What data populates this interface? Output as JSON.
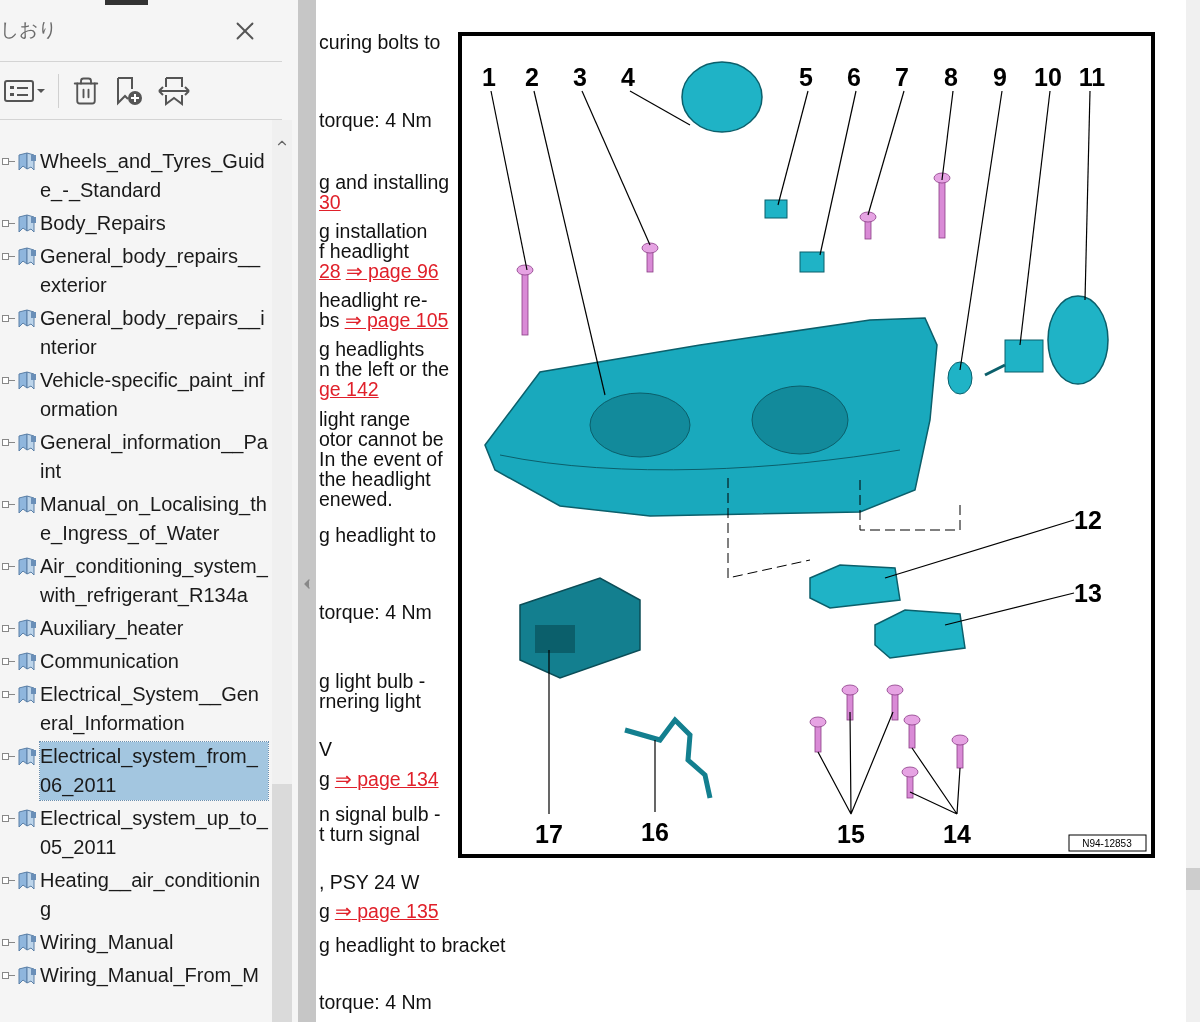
{
  "sidebar": {
    "title": "しおり",
    "items": [
      {
        "label": "Wheels_and_Tyres_Guide_-_Standard",
        "selected": false
      },
      {
        "label": "Body_Repairs",
        "selected": false
      },
      {
        "label": "General_body_repairs__exterior",
        "selected": false
      },
      {
        "label": "General_body_repairs__interior",
        "selected": false
      },
      {
        "label": "Vehicle-specific_paint_information",
        "selected": false
      },
      {
        "label": "General_information__Paint",
        "selected": false
      },
      {
        "label": "Manual_on_Localising_the_Ingress_of_Water",
        "selected": false
      },
      {
        "label": "Air_conditioning_system_with_refrigerant_R134a",
        "selected": false
      },
      {
        "label": "Auxiliary_heater",
        "selected": false
      },
      {
        "label": "Communication",
        "selected": false
      },
      {
        "label": "Electrical_System__General_Information",
        "selected": false
      },
      {
        "label": "Electrical_system_from_06_2011",
        "selected": true
      },
      {
        "label": "Electrical_system_up_to_05_2011",
        "selected": false
      },
      {
        "label": "Heating__air_conditioning",
        "selected": false
      },
      {
        "label": "Wiring_Manual",
        "selected": false
      },
      {
        "label": "Wiring_Manual_From_M",
        "selected": false
      }
    ]
  },
  "document": {
    "paragraphs": [
      {
        "lines": [
          [
            {
              "kind": "text",
              "text": "curing bolts to"
            }
          ]
        ]
      },
      {
        "lines": [
          [
            {
              "kind": "text",
              "text": "torque: 4 Nm"
            }
          ]
        ]
      },
      {
        "lines": [
          [
            {
              "kind": "text",
              "text": "g and installing"
            }
          ],
          [
            {
              "kind": "link",
              "text": "30"
            }
          ]
        ]
      },
      {
        "lines": [
          [
            {
              "kind": "text",
              "text": "g installation"
            }
          ],
          [
            {
              "kind": "text",
              "text": "f headlight"
            }
          ],
          [
            {
              "kind": "link",
              "text": "28"
            },
            {
              "kind": "link",
              "text": "⇒ page 96"
            }
          ]
        ]
      },
      {
        "lines": [
          [
            {
              "kind": "text",
              "text": "headlight re-"
            }
          ],
          [
            {
              "kind": "text",
              "text": "bs"
            },
            {
              "kind": "link",
              "text": "⇒ page 105"
            }
          ]
        ]
      },
      {
        "lines": [
          [
            {
              "kind": "text",
              "text": "g headlights"
            }
          ],
          [
            {
              "kind": "text",
              "text": "n the left or the"
            }
          ],
          [
            {
              "kind": "link",
              "text": "ge 142"
            }
          ]
        ]
      },
      {
        "lines": [
          [
            {
              "kind": "text",
              "text": "light range"
            }
          ],
          [
            {
              "kind": "text",
              "text": "otor cannot be"
            }
          ],
          [
            {
              "kind": "text",
              "text": "In the event of"
            }
          ],
          [
            {
              "kind": "text",
              "text": "the headlight"
            }
          ],
          [
            {
              "kind": "text",
              "text": "enewed."
            }
          ]
        ]
      },
      {
        "lines": [
          [
            {
              "kind": "text",
              "text": "g headlight to"
            }
          ]
        ]
      },
      {
        "lines": [
          [
            {
              "kind": "text",
              "text": "torque: 4 Nm"
            }
          ]
        ]
      },
      {
        "lines": [
          [
            {
              "kind": "text",
              "text": "g light bulb -"
            }
          ],
          [
            {
              "kind": "text",
              "text": "rnering light"
            }
          ]
        ]
      },
      {
        "lines": [
          [
            {
              "kind": "text",
              "text": "V"
            }
          ]
        ]
      },
      {
        "lines": [
          [
            {
              "kind": "text",
              "text": "g"
            },
            {
              "kind": "link",
              "text": "⇒ page 134"
            }
          ]
        ]
      },
      {
        "lines": [
          [
            {
              "kind": "text",
              "text": "n signal bulb -"
            }
          ],
          [
            {
              "kind": "text",
              "text": "t turn signal"
            }
          ]
        ]
      },
      {
        "lines": [
          [
            {
              "kind": "text",
              "text": ", PSY 24 W"
            }
          ]
        ]
      },
      {
        "lines": [
          [
            {
              "kind": "text",
              "text": "g"
            },
            {
              "kind": "link",
              "text": "⇒ page 135"
            }
          ]
        ]
      },
      {
        "lines": [
          [
            {
              "kind": "text",
              "text": "g headlight to bracket"
            }
          ]
        ]
      },
      {
        "lines": [
          [
            {
              "kind": "text",
              "text": "torque: 4 Nm"
            }
          ]
        ]
      }
    ],
    "figure": {
      "callouts": [
        "1",
        "2",
        "3",
        "4",
        "5",
        "6",
        "7",
        "8",
        "9",
        "10",
        "11",
        "12",
        "13",
        "17",
        "16",
        "15",
        "14"
      ],
      "code": "N94-12853"
    }
  }
}
